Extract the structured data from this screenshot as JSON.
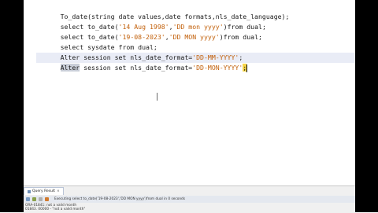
{
  "editor": {
    "lines": [
      {
        "segments": [
          "To_date(string date values,date formats,nls_date_language);"
        ]
      },
      {
        "segments": [
          "select to_date(",
          "'14 Aug 1998'",
          ",",
          "'DD mon yyyy'",
          ")from dual;"
        ]
      },
      {
        "segments": [
          "select to_date(",
          "'19-08-2023'",
          ",",
          "'DD MON yyyy'",
          ")from dual;"
        ]
      },
      {
        "segments": [
          "select sysdate from dual;"
        ]
      },
      {
        "segments": [
          "Alter session set nls_date_format=",
          "'DD-MM-YYYY'",
          ";"
        ]
      },
      {
        "segments": [
          "Alter",
          " session set nls_date_format=",
          "'DD-MON-YYYY'",
          ";"
        ]
      }
    ]
  },
  "results": {
    "tab_label": "Query Result",
    "tab_close": "×",
    "toolbar_text": "Executing select to_date('19-08-2023','DD MON yyyy')from dual in 0 seconds",
    "messages": [
      "ORA-01841: not a valid month",
      "01843. 00000 - \"not a valid month\""
    ]
  }
}
